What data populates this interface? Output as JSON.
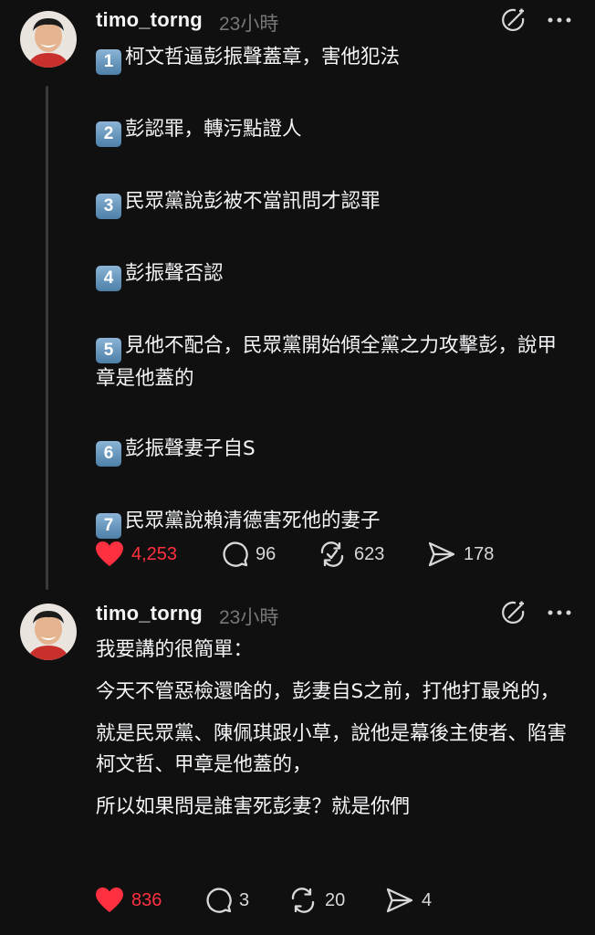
{
  "posts": [
    {
      "username": "timo_torng",
      "time": "23小時",
      "items": [
        {
          "num": "1",
          "text": "柯文哲逼彭振聲蓋章，害他犯法"
        },
        {
          "num": "2",
          "text": "彭認罪，轉污點證人"
        },
        {
          "num": "3",
          "text": "民眾黨說彭被不當訊問才認罪"
        },
        {
          "num": "4",
          "text": "彭振聲否認"
        },
        {
          "num": "5",
          "text": "見他不配合，民眾黨開始傾全黨之力攻擊彭，說甲章是他蓋的"
        },
        {
          "num": "6",
          "text": "彭振聲妻子自S"
        },
        {
          "num": "7",
          "text": "民眾黨說賴清德害死他的妻子"
        }
      ],
      "likes": "4,253",
      "replies": "96",
      "reposts": "623",
      "shares": "178"
    },
    {
      "username": "timo_torng",
      "time": "23小時",
      "paragraphs": [
        "我要講的很簡單：",
        "今天不管惡檢還啥的，彭妻自S之前，打他打最兇的，",
        "就是民眾黨、陳佩琪跟小草，說他是幕後主使者、陷害柯文哲、甲章是他蓋的，",
        "所以如果問是誰害死彭妻？就是你們"
      ],
      "likes": "836",
      "replies": "3",
      "reposts": "20",
      "shares": "4"
    }
  ],
  "colors": {
    "background": "#101010",
    "like_red": "#ff3040",
    "muted": "#777777",
    "text": "#f3f5f7"
  },
  "icons": [
    "avatar",
    "translate-icon",
    "more-icon",
    "heart-icon",
    "comment-icon",
    "repost-icon",
    "share-icon"
  ]
}
